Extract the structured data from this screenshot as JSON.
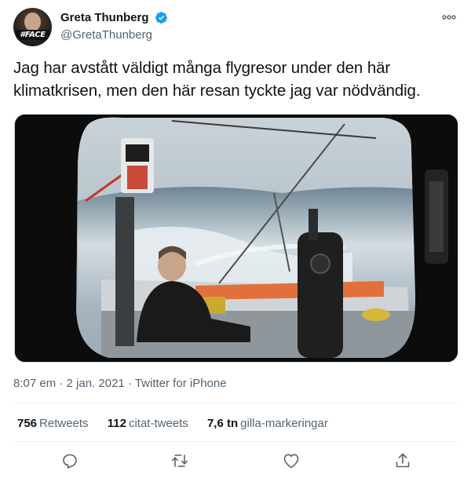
{
  "user": {
    "display_name": "Greta Thunberg",
    "handle": "@GretaThunberg",
    "avatar_badge": "#FACE",
    "verified": true
  },
  "tweet": {
    "text": "Jag har avstått väldigt många flygresor under den här klimatkrisen, men den här resan tyckte jag var nödvändig."
  },
  "meta": {
    "time": "8:07 em",
    "separator": " · ",
    "date": "2 jan. 2021",
    "source": "Twitter for iPhone"
  },
  "stats": {
    "retweets_count": "756",
    "retweets_label": "Retweets",
    "quotes_count": "112",
    "quotes_label": "citat-tweets",
    "likes_count": "7,6 tn",
    "likes_label": "gilla-markeringar"
  },
  "icons": {
    "verified": "verified-badge-icon",
    "more": "more-icon",
    "reply": "reply-icon",
    "retweet": "retweet-icon",
    "like": "heart-icon",
    "share": "share-icon"
  },
  "colors": {
    "text": "#0f1419",
    "secondary": "#536471",
    "verified_blue": "#1d9bf0",
    "divider": "#eff3f4"
  }
}
